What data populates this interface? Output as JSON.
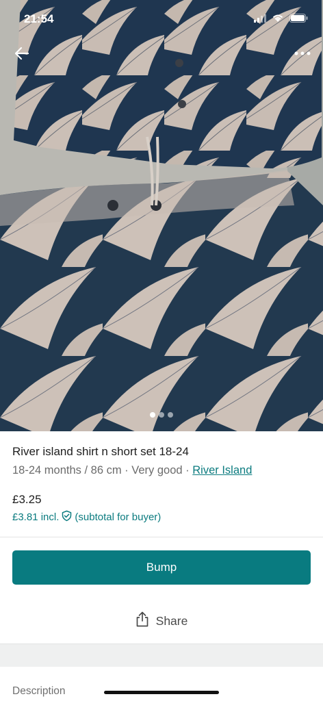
{
  "status_bar": {
    "time": "21:54"
  },
  "photo": {
    "description_icon": "product-photo",
    "page_count": 3,
    "active_page": 1
  },
  "listing": {
    "title": "River island shirt n short set 18-24",
    "size": "18-24 months / 86 cm",
    "condition": "Very good",
    "separator": "·",
    "brand": "River Island",
    "price": "£3.25",
    "price_incl": "£3.81 incl.",
    "price_incl_note": "(subtotal for buyer)"
  },
  "actions": {
    "bump_label": "Bump",
    "share_label": "Share"
  },
  "sections": {
    "description_label": "Description"
  },
  "colors": {
    "accent": "#097b80",
    "link": "#0b7b7f",
    "fabric_navy": "#1f3650",
    "fabric_beige": "#c8bcb3"
  }
}
